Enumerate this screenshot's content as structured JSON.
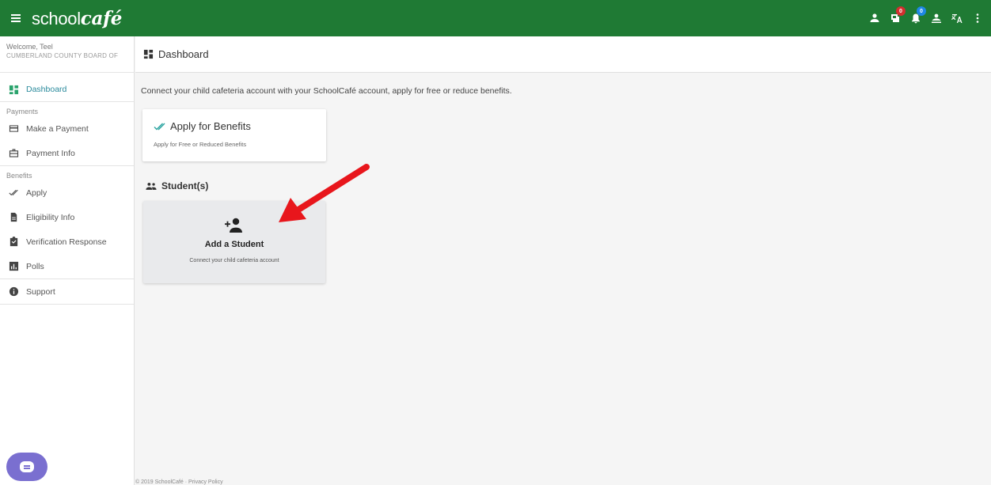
{
  "app": {
    "logo_light": "school",
    "logo_script": "café",
    "brand_color": "#1f7a34"
  },
  "topbar": {
    "icons": [
      {
        "name": "person-icon"
      },
      {
        "name": "messages-icon",
        "badge": "0",
        "badge_color": "#d32f2f"
      },
      {
        "name": "notifications-icon",
        "badge": "0",
        "badge_color": "#1e88e5"
      },
      {
        "name": "account-switch-icon"
      },
      {
        "name": "translate-icon"
      },
      {
        "name": "more-vert-icon"
      }
    ]
  },
  "sidebar": {
    "welcome": "Welcome, Teel",
    "district": "CUMBERLAND COUNTY BOARD OF",
    "dashboard_label": "Dashboard",
    "payments_section": "Payments",
    "make_payment": "Make a Payment",
    "payment_info": "Payment Info",
    "benefits_section": "Benefits",
    "apply": "Apply",
    "eligibility_info": "Eligibility Info",
    "verification_response": "Verification Response",
    "polls": "Polls",
    "support": "Support"
  },
  "main": {
    "header_title": "Dashboard",
    "intro": "Connect your child cafeteria account with your SchoolCafé account, apply for free or reduce benefits.",
    "benefit_card": {
      "title": "Apply for Benefits",
      "subtitle": "Apply for Free or Reduced Benefits"
    },
    "students_heading": "Student(s)",
    "add_student": {
      "title": "Add a Student",
      "subtitle": "Connect your child cafeteria account"
    },
    "annotation_arrow_color": "#e8161c",
    "footer": "© 2019 SchoolCafé  ·  Privacy Policy"
  }
}
